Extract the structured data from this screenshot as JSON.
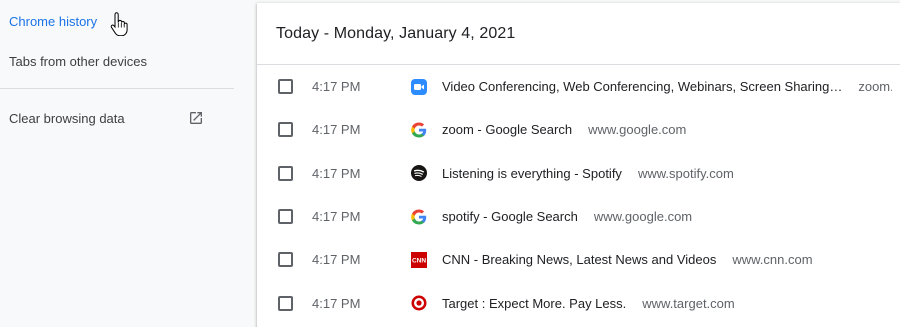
{
  "sidebar": {
    "history_label": "Chrome history",
    "tabs_label": "Tabs from other devices",
    "clear_label": "Clear browsing data"
  },
  "main": {
    "date_header": "Today - Monday, January 4, 2021",
    "entries": [
      {
        "time": "4:17 PM",
        "title": "Video Conferencing, Web Conferencing, Webinars, Screen Sharing…",
        "domain": "zoom.us",
        "icon": "zoom-icon"
      },
      {
        "time": "4:17 PM",
        "title": "zoom - Google Search",
        "domain": "www.google.com",
        "icon": "google-icon"
      },
      {
        "time": "4:17 PM",
        "title": "Listening is everything - Spotify",
        "domain": "www.spotify.com",
        "icon": "spotify-icon"
      },
      {
        "time": "4:17 PM",
        "title": "spotify - Google Search",
        "domain": "www.google.com",
        "icon": "google-icon"
      },
      {
        "time": "4:17 PM",
        "title": "CNN - Breaking News, Latest News and Videos",
        "domain": "www.cnn.com",
        "icon": "cnn-icon"
      },
      {
        "time": "4:17 PM",
        "title": "Target : Expect More. Pay Less.",
        "domain": "www.target.com",
        "icon": "target-icon"
      }
    ]
  },
  "colors": {
    "accent": "#1a73e8",
    "background": "#f8f9fa",
    "card": "#ffffff",
    "zoom": "#2d8cff",
    "cnn": "#cc0000",
    "target": "#cc0000",
    "spotify": "#191414"
  }
}
